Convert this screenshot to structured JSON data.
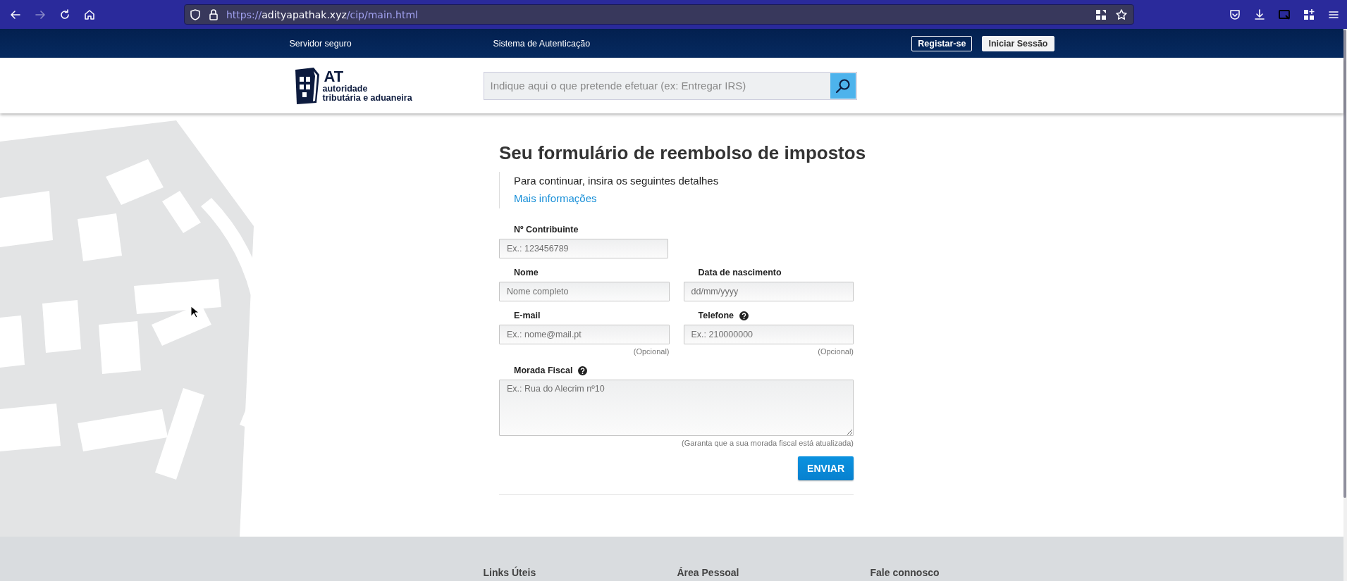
{
  "browser": {
    "nav_buttons": [
      {
        "kind": "back",
        "disabled": false
      },
      {
        "kind": "forward",
        "disabled": true
      },
      {
        "kind": "reload",
        "disabled": false
      },
      {
        "kind": "home",
        "disabled": false
      }
    ],
    "url": {
      "scheme": "https://",
      "host": "adityapathak.xyz",
      "path": "/cip/main.html"
    }
  },
  "top_bar": {
    "links": [
      "Servidor seguro",
      "Sistema de Autenticação"
    ],
    "buttons": [
      {
        "label": "Registar-se",
        "kind": "outline"
      },
      {
        "label": "Iniciar Sessão",
        "kind": "solid"
      }
    ]
  },
  "header": {
    "logo": {
      "mark": "AT",
      "line_1": "autoridade",
      "line_2": "tributária e aduaneira"
    },
    "search": {
      "placeholder": "Indique aqui o que pretende efetuar (ex: Entregar IRS)"
    }
  },
  "form": {
    "title": "Seu formulário de reembolso de impostos",
    "intro": "Para continuar, insira os seguintes detalhes",
    "link": "Mais informações",
    "rows": [
      [
        {
          "label": "Nº Contribuinte",
          "placeholder": "Ex.: 123456789",
          "kind": "input",
          "help": false
        }
      ],
      [
        {
          "label": "Nome",
          "placeholder": "Nome completo",
          "kind": "input",
          "help": false
        },
        {
          "label": "Data de nascimento",
          "placeholder": "dd/mm/yyyy",
          "kind": "input",
          "help": false
        }
      ],
      [
        {
          "label": "E-mail",
          "placeholder": "Ex.: nome@mail.pt",
          "kind": "input",
          "help": false,
          "note": "(Opcional)"
        },
        {
          "label": "Telefone",
          "placeholder": "Ex.: 210000000",
          "kind": "input",
          "help": true,
          "note": "(Opcional)"
        }
      ],
      [
        {
          "label": "Morada Fiscal",
          "placeholder": "Ex.: Rua do Alecrim nº10",
          "kind": "textarea",
          "help": true,
          "note": "(Garanta que a sua morada fiscal está atualizada)"
        }
      ]
    ],
    "submit": "ENVIAR"
  },
  "footer": {
    "columns": [
      "Links Úteis",
      "Área Pessoal",
      "Fale connosco"
    ]
  }
}
